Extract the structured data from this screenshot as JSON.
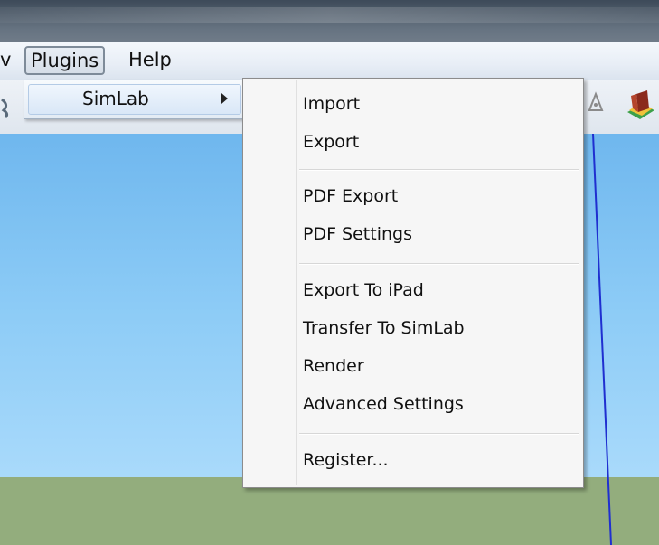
{
  "menubar": {
    "truncated_label": "v",
    "plugins_label": "Plugins",
    "help_label": "Help"
  },
  "submenu": {
    "label": "SimLab"
  },
  "dropdown": {
    "items": [
      "Import",
      "Export",
      "PDF Export",
      "PDF Settings",
      "Export To iPad",
      "Transfer To SimLab",
      "Render",
      "Advanced Settings",
      "Register..."
    ]
  },
  "colors": {
    "sky": "#8ccbf6",
    "ground": "#93ad7d",
    "axis_blue": "#1f2fd0"
  },
  "icons": [
    "walk-tool-icon",
    "orbit-tool-icon",
    "house-icon"
  ]
}
